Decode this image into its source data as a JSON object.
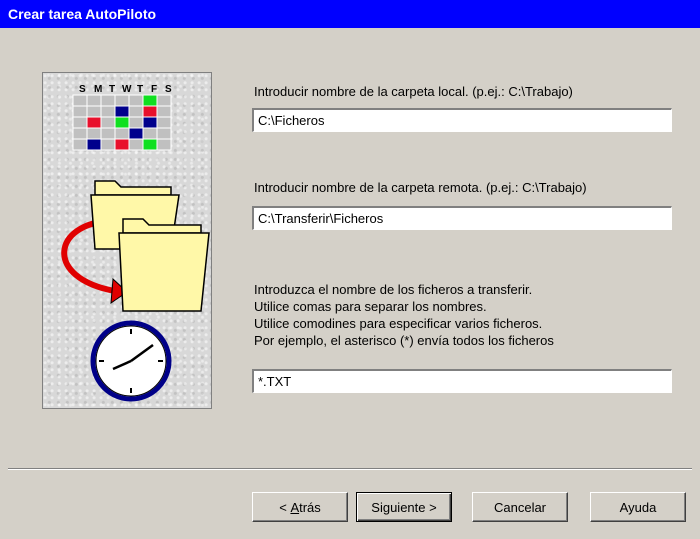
{
  "window": {
    "title": "Crear tarea AutoPiloto"
  },
  "illustration": {
    "weekday_letters": [
      "S",
      "M",
      "T",
      "W",
      "T",
      "F",
      "S"
    ],
    "colors": {
      "red": "#e8102c",
      "green": "#10e020",
      "blue": "#00008c",
      "cell": "#c0c0c0",
      "folder": "#fff8a8",
      "arrow": "#e00000",
      "clock_rim": "#000088"
    },
    "icons": [
      "calendar-icon",
      "folders-transfer-icon",
      "clock-icon"
    ]
  },
  "local_folder": {
    "label": "Introducir nombre de la carpeta local. (p.ej.: C:\\Trabajo)",
    "value": "C:\\Ficheros"
  },
  "remote_folder": {
    "label": "Introducir nombre de la carpeta remota. (p.ej.: C:\\Trabajo)",
    "value": "C:\\Transferir\\Ficheros"
  },
  "files": {
    "instructions": [
      "Introduzca el nombre de los ficheros a transferir.",
      "Utilice comas para separar los nombres.",
      "Utilice comodines para especificar varios ficheros.",
      "Por ejemplo, el asterisco (*) envía todos los ficheros"
    ],
    "value": "*.TXT"
  },
  "buttons": {
    "back_prefix": "< ",
    "back_accel": "A",
    "back_rest": "trás",
    "next": "Siguiente >",
    "cancel": "Cancelar",
    "help": "Ayuda"
  }
}
